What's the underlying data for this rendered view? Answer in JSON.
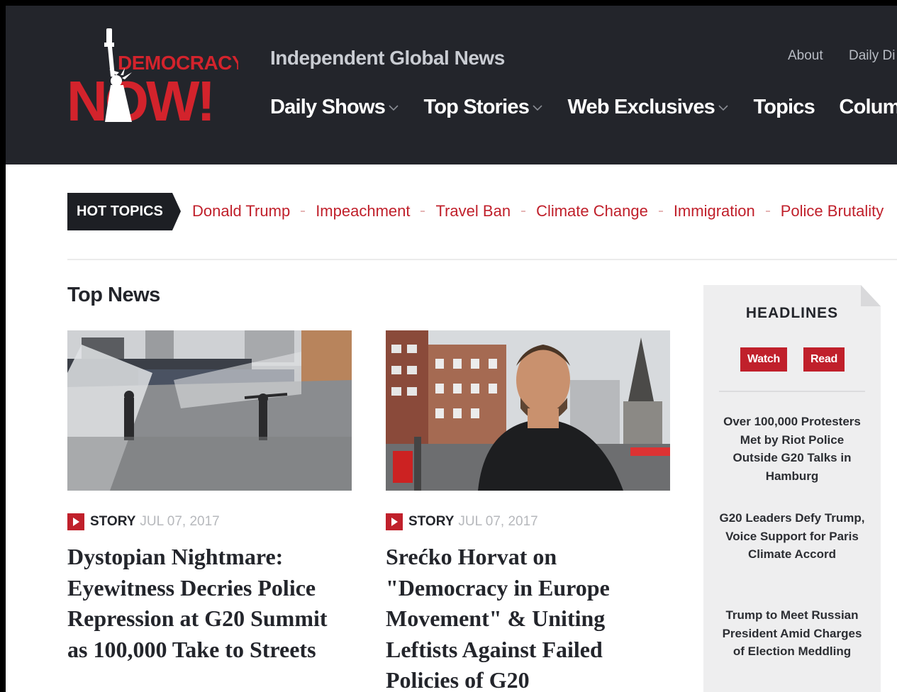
{
  "header": {
    "logo_text_top": "DEMOCRACY",
    "logo_text_bottom": "NOW!",
    "tagline": "Independent Global News",
    "util_links": [
      "About",
      "Daily Di"
    ],
    "nav": [
      {
        "label": "Daily Shows",
        "has_dropdown": true
      },
      {
        "label": "Top Stories",
        "has_dropdown": true
      },
      {
        "label": "Web Exclusives",
        "has_dropdown": true
      },
      {
        "label": "Topics",
        "has_dropdown": false
      },
      {
        "label": "Columns",
        "has_dropdown": false
      }
    ]
  },
  "hot_topics": {
    "label": "HOT TOPICS",
    "items": [
      "Donald Trump",
      "Impeachment",
      "Travel Ban",
      "Climate Change",
      "Immigration",
      "Police Brutality"
    ]
  },
  "top_news": {
    "title": "Top News",
    "stories": [
      {
        "type": "STORY",
        "date": "JUL 07, 2017",
        "headline": "Dystopian Nightmare: Eyewitness Decries Police Repression at G20 Summit as 100,000 Take to Streets"
      },
      {
        "type": "STORY",
        "date": "JUL 07, 2017",
        "headline": "Srećko Horvat on \"Democracy in Europe Movement\" & Uniting Leftists Against Failed Policies of G20"
      }
    ]
  },
  "headlines": {
    "title": "HEADLINES",
    "watch_label": "Watch",
    "read_label": "Read",
    "items": [
      "Over 100,000 Protesters Met by Riot Police Outside G20 Talks in Hamburg",
      "G20 Leaders Defy Trump, Voice Support for Paris Climate Accord",
      "Trump to Meet Russian President Amid Charges of Election Meddling"
    ]
  },
  "colors": {
    "header_bg": "#23252b",
    "accent_red": "#c0202b",
    "text_dark": "#23252b"
  }
}
